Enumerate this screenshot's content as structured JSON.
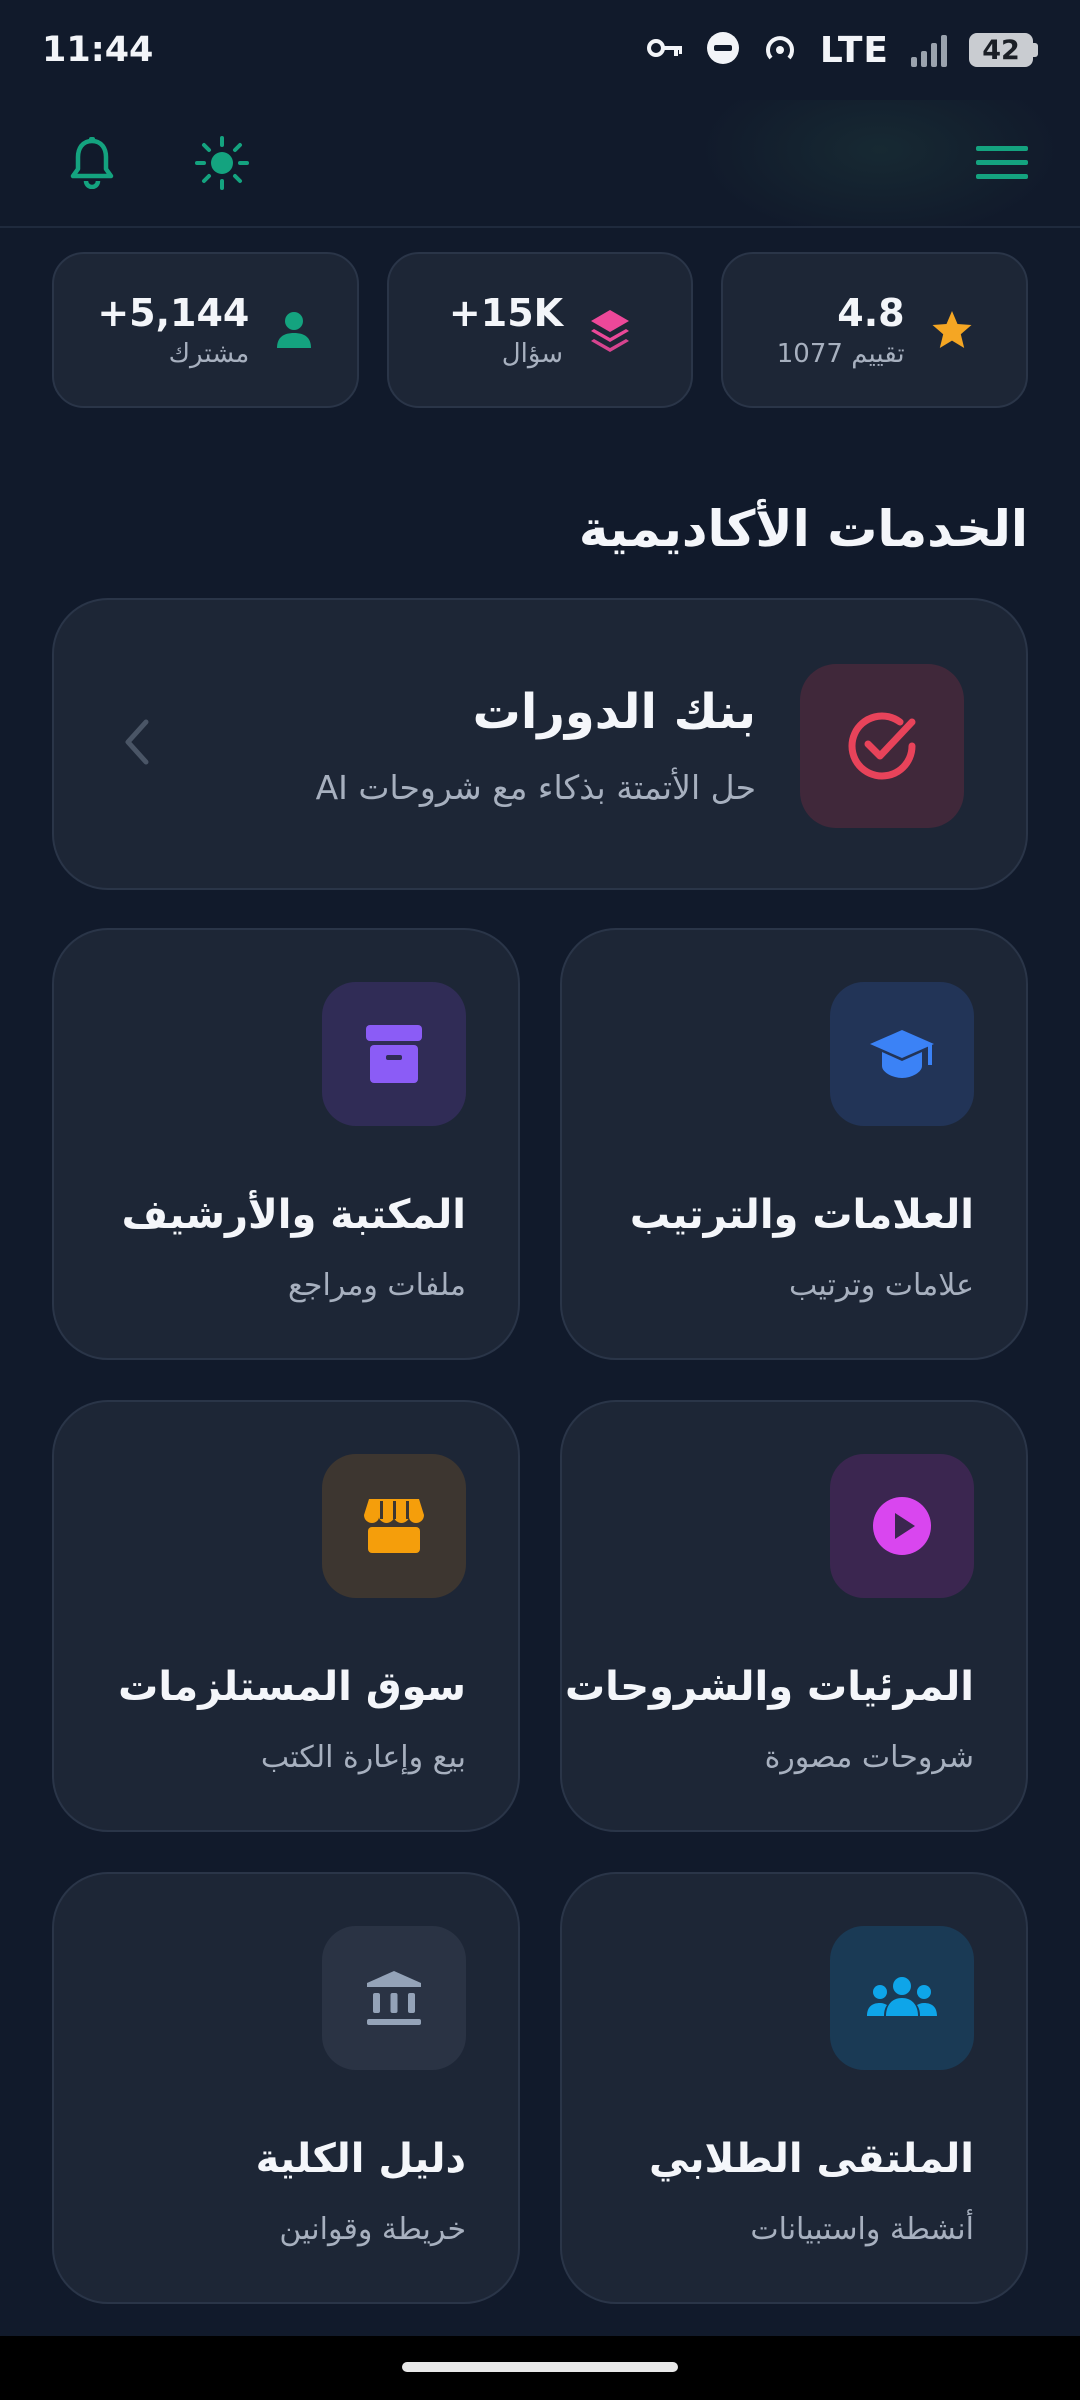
{
  "status": {
    "time": "11:44",
    "network": "LTE",
    "battery": "42"
  },
  "stats": [
    {
      "value": "4.8",
      "label": "1077 تقييم",
      "icon": "star-icon",
      "color": "#f5a623"
    },
    {
      "value": "+15K",
      "label": "سؤال",
      "icon": "layers-icon",
      "color": "#ec4899"
    },
    {
      "value": "+5,144",
      "label": "مشترك",
      "icon": "user-icon",
      "color": "#14a37f"
    }
  ],
  "section": {
    "title": "الخدمات الأكاديمية"
  },
  "featured": {
    "title": "بنك الدورات",
    "subtitle": "حل الأتمتة بذكاء مع شروحات AI",
    "icon": "check-circle-icon",
    "color": "#e8435a"
  },
  "cards": [
    {
      "title": "العلامات والترتيب",
      "subtitle": "علامات وترتيب",
      "icon": "graduation-cap-icon",
      "color": "#3b82f6"
    },
    {
      "title": "المكتبة والأرشيف",
      "subtitle": "ملفات ومراجع",
      "icon": "archive-icon",
      "color": "#8b5cf6"
    },
    {
      "title": "المرئيات والشروحات",
      "subtitle": "شروحات مصورة",
      "icon": "play-icon",
      "color": "#d946ef"
    },
    {
      "title": "سوق المستلزمات",
      "subtitle": "بيع وإعارة الكتب",
      "icon": "store-icon",
      "color": "#f59e0b"
    },
    {
      "title": "الملتقى الطلابي",
      "subtitle": "أنشطة واستبيانات",
      "icon": "users-icon",
      "color": "#0ea5e9"
    },
    {
      "title": "دليل الكلية",
      "subtitle": "خريطة وقوانين",
      "icon": "institution-icon",
      "color": "#94a3b8"
    }
  ],
  "colors": {
    "accent": "#14a37f",
    "background": "#111a2b",
    "card": "#1d2636"
  }
}
